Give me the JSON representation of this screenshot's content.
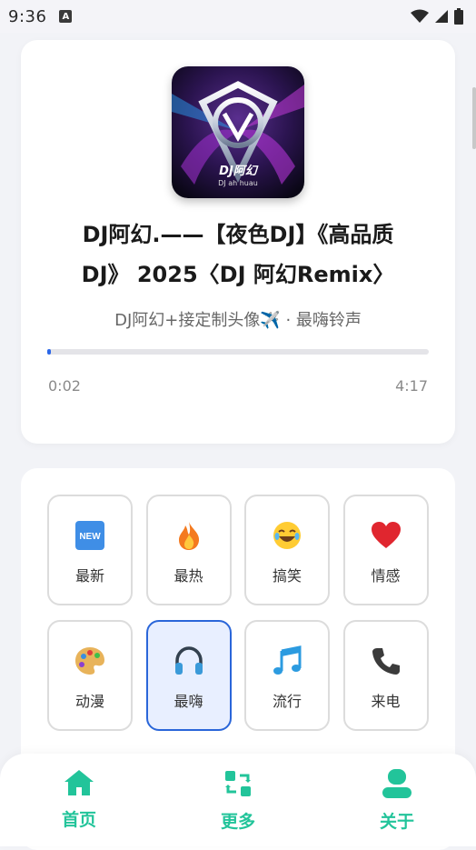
{
  "status_bar": {
    "time": "9:36",
    "a_badge": "A"
  },
  "player": {
    "cover_text_main": "DJ阿幻",
    "cover_text_sub": "DJ ah huau",
    "title_line1": "DJ阿幻.——【夜色DJ】《高品质",
    "title_line2": "DJ》 2025〈DJ 阿幻Remix〉",
    "subtitle": "DJ阿幻+接定制头像✈️ · 最嗨铃声",
    "current_time": "0:02",
    "total_time": "4:17",
    "progress_fraction": 0.008
  },
  "categories": [
    {
      "label": "最新",
      "icon": "new-badge-icon",
      "active": false
    },
    {
      "label": "最热",
      "icon": "fire-icon",
      "active": false
    },
    {
      "label": "搞笑",
      "icon": "laughing-face-icon",
      "active": false
    },
    {
      "label": "情感",
      "icon": "heart-icon",
      "active": false
    },
    {
      "label": "动漫",
      "icon": "palette-icon",
      "active": false
    },
    {
      "label": "最嗨",
      "icon": "headphones-icon",
      "active": true
    },
    {
      "label": "流行",
      "icon": "music-note-icon",
      "active": false
    },
    {
      "label": "来电",
      "icon": "phone-icon",
      "active": false
    }
  ],
  "nav": {
    "home": "首页",
    "more": "更多",
    "about": "关于",
    "accent_color": "#22c49a"
  },
  "colors": {
    "active_border": "#2a66d9",
    "progress": "#2b67e8"
  }
}
